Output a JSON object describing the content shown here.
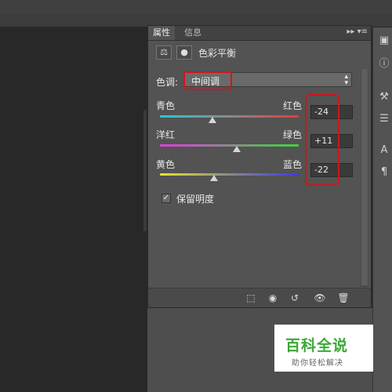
{
  "panel": {
    "tabs": [
      {
        "label": "属性",
        "active": true
      },
      {
        "label": "信息",
        "active": false
      }
    ],
    "tab_menu_icons": "▸▸ ▾≡",
    "adjustment_title": "色彩平衡",
    "tone": {
      "label": "色调:",
      "value": "中间调"
    },
    "sliders": [
      {
        "left": "青色",
        "right": "红色",
        "value": "-24",
        "amount": -24
      },
      {
        "left": "洋红",
        "right": "绿色",
        "value": "+11",
        "amount": 11
      },
      {
        "left": "黄色",
        "right": "蓝色",
        "value": "-22",
        "amount": -22
      }
    ],
    "preserve_luminosity": {
      "label": "保留明度",
      "checked": true
    }
  },
  "watermark": {
    "main": "百科全说",
    "sub": "助你轻松解决"
  },
  "colors": {
    "annotation": "#d0151c",
    "panel_bg": "#535353",
    "watermark_green": "#3aa936"
  }
}
